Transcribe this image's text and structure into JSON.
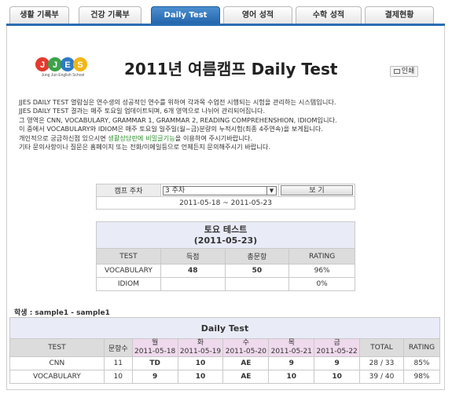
{
  "tabs": [
    {
      "label": "생활 기록부",
      "active": false
    },
    {
      "label": "건강 기록부",
      "active": false
    },
    {
      "label": "Daily Test",
      "active": true
    },
    {
      "label": "영어 성적",
      "active": false
    },
    {
      "label": "수학 성적",
      "active": false
    },
    {
      "label": "결제현황",
      "active": false
    }
  ],
  "header": {
    "logo_text": "Jung Jun English School",
    "title": "2011년 여름캠프 Daily Test",
    "print_label": "인쇄"
  },
  "description": {
    "line1": "JJES DAILY TEST 열람실은 연수생의 성공적인 연수를 위하여 각과목 수업전 시행되는 시험을 관리하는 시스템입니다.",
    "line2": "JJES DAILY TEST 결과는 매주 토요일 업데이트되며, 6개 영역으로 나뉘어 관리되어집니다.",
    "line3": "그 영역은 CNN, VOCABULARY, GRAMMAR 1, GRAMMAR 2, READING COMPREHENSHION, IDIOM입니다.",
    "line4": "이 중에서 VOCABULARY와 IDIOM은 매주 토요일 일주일(월~금)분량의 누적시험(최종 4주연속)을 보게됩니다.",
    "line5_pre": "개인적으로 궁금하신점 있으시면 ",
    "line5_hl": "생활상담란에 비밀글기능",
    "line5_post": "을 이용하여 주시기바랍니다.",
    "line6": "기타 문의사항이나 질문은 홈페이지 또는 전화/이메일등으로 언제든지 문의해주시기 바랍니다."
  },
  "week_selector": {
    "label": "캠프 주차",
    "selected": "3 주차",
    "button": "보 기",
    "date_range": "2011-05-18 ~ 2011-05-23"
  },
  "saturday_test": {
    "title": "토요 테스트",
    "date": "(2011-05-23)",
    "columns": [
      "TEST",
      "득점",
      "총문항",
      "RATING"
    ],
    "rows": [
      {
        "test": "VOCABULARY",
        "score": "48",
        "total": "50",
        "rating": "96%"
      },
      {
        "test": "IDIOM",
        "score": "",
        "total": "",
        "rating": "0%"
      }
    ]
  },
  "student": "학생 : sample1 - sample1",
  "daily_test": {
    "title": "Daily Test",
    "col_test": "TEST",
    "col_count": "문항수",
    "days": [
      {
        "day": "월",
        "date": "2011-05-18"
      },
      {
        "day": "화",
        "date": "2011-05-19"
      },
      {
        "day": "수",
        "date": "2011-05-20"
      },
      {
        "day": "목",
        "date": "2011-05-21"
      },
      {
        "day": "금",
        "date": "2011-05-22"
      }
    ],
    "col_total": "TOTAL",
    "col_rating": "RATING",
    "rows": [
      {
        "test": "CNN",
        "count": "11",
        "d1": "TD",
        "d2": "10",
        "d3": "AE",
        "d4": "9",
        "d5": "9",
        "total": "28 / 33",
        "rating": "85%"
      },
      {
        "test": "VOCABULARY",
        "count": "10",
        "d1": "9",
        "d2": "10",
        "d3": "AE",
        "d4": "10",
        "d5": "10",
        "total": "39 / 40",
        "rating": "98%"
      }
    ]
  }
}
